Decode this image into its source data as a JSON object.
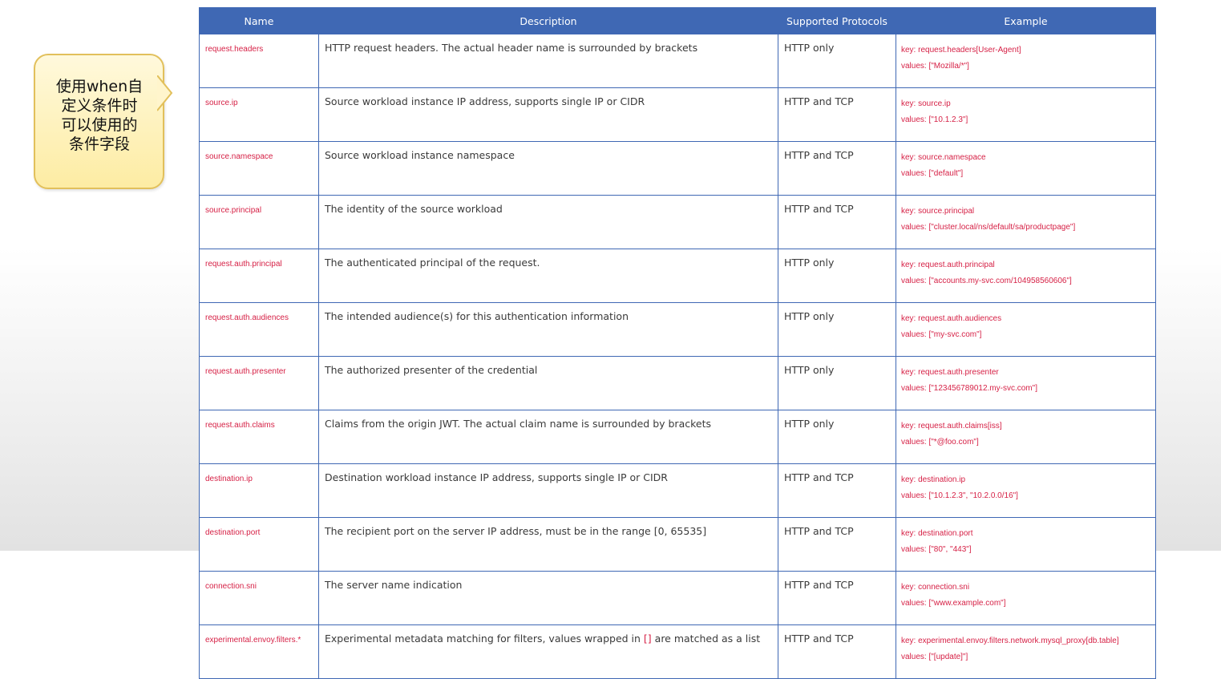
{
  "callout": {
    "lines": [
      "使用when自",
      "定义条件时",
      "可以使用的",
      "条件字段"
    ]
  },
  "table": {
    "headers": [
      "Name",
      "Description",
      "Supported Protocols",
      "Example"
    ],
    "rows": [
      {
        "name": "request.headers",
        "desc": "HTTP request headers. The actual header name is surrounded by brackets",
        "proto": "HTTP only",
        "ex_key": "key: request.headers[User-Agent]",
        "ex_val": "values: [\"Mozilla/*\"]"
      },
      {
        "name": "source.ip",
        "desc": "Source workload instance IP address, supports single IP or CIDR",
        "proto": "HTTP and TCP",
        "ex_key": "key: source.ip",
        "ex_val": "values: [\"10.1.2.3\"]"
      },
      {
        "name": "source.namespace",
        "desc": "Source workload instance namespace",
        "proto": "HTTP and TCP",
        "ex_key": "key: source.namespace",
        "ex_val": "values: [\"default\"]"
      },
      {
        "name": "source.principal",
        "desc": "The identity of the source workload",
        "proto": "HTTP and TCP",
        "ex_key": "key: source.principal",
        "ex_val": "values: [\"cluster.local/ns/default/sa/productpage\"]"
      },
      {
        "name": "request.auth.principal",
        "desc": "The authenticated principal of the request.",
        "proto": "HTTP only",
        "ex_key": "key: request.auth.principal",
        "ex_val": "values: [\"accounts.my-svc.com/104958560606\"]"
      },
      {
        "name": "request.auth.audiences",
        "desc": "The intended audience(s) for this authentication information",
        "proto": "HTTP only",
        "ex_key": "key: request.auth.audiences",
        "ex_val": "values: [\"my-svc.com\"]"
      },
      {
        "name": "request.auth.presenter",
        "desc": "The authorized presenter of the credential",
        "proto": "HTTP only",
        "ex_key": "key: request.auth.presenter",
        "ex_val": "values: [\"123456789012.my-svc.com\"]"
      },
      {
        "name": "request.auth.claims",
        "desc": "Claims from the origin JWT. The actual claim name is surrounded by brackets",
        "proto": "HTTP only",
        "ex_key": "key: request.auth.claims[iss]",
        "ex_val": "values: [\"*@foo.com\"]"
      },
      {
        "name": "destination.ip",
        "desc": "Destination workload instance IP address, supports single IP or CIDR",
        "proto": "HTTP and TCP",
        "ex_key": "key: destination.ip",
        "ex_val": "values: [\"10.1.2.3\", \"10.2.0.0/16\"]"
      },
      {
        "name": "destination.port",
        "desc": "The recipient port on the server IP address, must be in the range [0, 65535]",
        "proto": "HTTP and TCP",
        "ex_key": "key: destination.port",
        "ex_val": "values: [\"80\", \"443\"]"
      },
      {
        "name": "connection.sni",
        "desc": "The server name indication",
        "proto": "HTTP and TCP",
        "ex_key": "key: connection.sni",
        "ex_val": "values: [\"www.example.com\"]"
      },
      {
        "name": "experimental.envoy.filters.*",
        "desc_pre": "Experimental metadata matching for filters, values wrapped in ",
        "desc_bracket": "[]",
        "desc_post": " are matched as a list",
        "proto": "HTTP and TCP",
        "ex_key": "key: experimental.envoy.filters.network.mysql_proxy[db.table]",
        "ex_val": "values: [\"[update]\"]"
      }
    ]
  },
  "colors": {
    "header_bg": "#3f68b4",
    "name_text": "#d62146",
    "callout_bg": "#fdeca3",
    "callout_border": "#e2c05b"
  }
}
